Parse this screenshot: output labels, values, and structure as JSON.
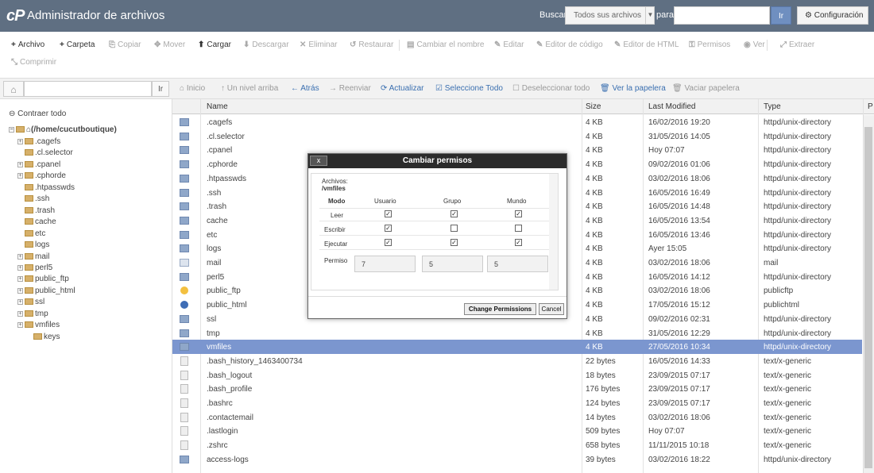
{
  "header": {
    "logo": "cP",
    "title": "Administrador de archivos",
    "search_label": "Buscar",
    "search_scope": "Todos sus archivos",
    "para_label": "para",
    "go_label": "Ir",
    "settings_label": "Configuración"
  },
  "toolbar": {
    "items": [
      {
        "icon": "+",
        "label": "Archivo",
        "enabled": true
      },
      {
        "icon": "+",
        "label": "Carpeta",
        "enabled": true
      },
      {
        "icon": "⎘",
        "label": "Copiar",
        "enabled": false
      },
      {
        "icon": "✥",
        "label": "Mover",
        "enabled": false
      },
      {
        "icon": "⬆",
        "label": "Cargar",
        "enabled": true
      },
      {
        "icon": "⬇",
        "label": "Descargar",
        "enabled": false
      },
      {
        "icon": "✕",
        "label": "Eliminar",
        "enabled": false
      },
      {
        "icon": "↺",
        "label": "Restaurar",
        "enabled": false
      },
      {
        "icon": "▤",
        "label": "Cambiar el nombre",
        "enabled": false
      },
      {
        "icon": "✎",
        "label": "Editar",
        "enabled": false
      },
      {
        "icon": "✎",
        "label": "Editor de código",
        "enabled": false
      },
      {
        "icon": "✎",
        "label": "Editor de HTML",
        "enabled": false
      },
      {
        "icon": "⚿",
        "label": "Permisos",
        "enabled": false
      },
      {
        "icon": "◉",
        "label": "Ver",
        "enabled": false
      },
      {
        "icon": "⤢",
        "label": "Extraer",
        "enabled": false
      },
      {
        "icon": "⤡",
        "label": "Comprimir",
        "enabled": false
      }
    ]
  },
  "navbar": {
    "go_label": "Ir",
    "items": [
      {
        "icon": "⌂",
        "label": "Inicio",
        "style": "gray"
      },
      {
        "icon": "↑",
        "label": "Un nivel arriba",
        "style": "gray"
      },
      {
        "icon": "←",
        "label": "Atrás",
        "style": "blue"
      },
      {
        "icon": "→",
        "label": "Reenviar",
        "style": "gray"
      },
      {
        "icon": "⟳",
        "label": "Actualizar",
        "style": "blue"
      },
      {
        "icon": "☑",
        "label": "Seleccione Todo",
        "style": "blue"
      },
      {
        "icon": "☐",
        "label": "Deseleccionar todo",
        "style": "gray"
      },
      {
        "icon": "🗑",
        "label": "Ver la papelera",
        "style": "blue"
      },
      {
        "icon": "🗑",
        "label": "Vaciar papelera",
        "style": "gray"
      }
    ]
  },
  "tree": {
    "collapse_label": "Contraer todo",
    "root": "(/home/cucutboutique)",
    "items": [
      {
        "name": ".cagefs",
        "pm": true
      },
      {
        "name": ".cl.selector",
        "pm": false
      },
      {
        "name": ".cpanel",
        "pm": true
      },
      {
        "name": ".cphorde",
        "pm": true
      },
      {
        "name": ".htpasswds",
        "pm": false
      },
      {
        "name": ".ssh",
        "pm": false
      },
      {
        "name": ".trash",
        "pm": false
      },
      {
        "name": "cache",
        "pm": false
      },
      {
        "name": "etc",
        "pm": false
      },
      {
        "name": "logs",
        "pm": false
      },
      {
        "name": "mail",
        "pm": true
      },
      {
        "name": "perl5",
        "pm": true
      },
      {
        "name": "public_ftp",
        "pm": true
      },
      {
        "name": "public_html",
        "pm": true
      },
      {
        "name": "ssl",
        "pm": true
      },
      {
        "name": "tmp",
        "pm": true
      },
      {
        "name": "vmfiles",
        "pm": true
      }
    ],
    "sub": "keys"
  },
  "table": {
    "headers": {
      "name": "Name",
      "size": "Size",
      "modified": "Last Modified",
      "type": "Type",
      "extra": "P"
    },
    "rows": [
      {
        "icon": "dir",
        "name": ".cagefs",
        "size": "4 KB",
        "modified": "16/02/2016 19:20",
        "type": "httpd/unix-directory"
      },
      {
        "icon": "dir",
        "name": ".cl.selector",
        "size": "4 KB",
        "modified": "31/05/2016 14:05",
        "type": "httpd/unix-directory"
      },
      {
        "icon": "dir",
        "name": ".cpanel",
        "size": "4 KB",
        "modified": "Hoy 07:07",
        "type": "httpd/unix-directory"
      },
      {
        "icon": "dir",
        "name": ".cphorde",
        "size": "4 KB",
        "modified": "09/02/2016 01:06",
        "type": "httpd/unix-directory"
      },
      {
        "icon": "dir",
        "name": ".htpasswds",
        "size": "4 KB",
        "modified": "03/02/2016 18:06",
        "type": "httpd/unix-directory"
      },
      {
        "icon": "dir",
        "name": ".ssh",
        "size": "4 KB",
        "modified": "16/05/2016 16:49",
        "type": "httpd/unix-directory"
      },
      {
        "icon": "dir",
        "name": ".trash",
        "size": "4 KB",
        "modified": "16/05/2016 14:48",
        "type": "httpd/unix-directory"
      },
      {
        "icon": "dir",
        "name": "cache",
        "size": "4 KB",
        "modified": "16/05/2016 13:54",
        "type": "httpd/unix-directory"
      },
      {
        "icon": "dir",
        "name": "etc",
        "size": "4 KB",
        "modified": "16/05/2016 13:46",
        "type": "httpd/unix-directory"
      },
      {
        "icon": "dir",
        "name": "logs",
        "size": "4 KB",
        "modified": "Ayer 15:05",
        "type": "httpd/unix-directory"
      },
      {
        "icon": "mail",
        "name": "mail",
        "size": "4 KB",
        "modified": "03/02/2016 18:06",
        "type": "mail"
      },
      {
        "icon": "dir",
        "name": "perl5",
        "size": "4 KB",
        "modified": "16/05/2016 14:12",
        "type": "httpd/unix-directory"
      },
      {
        "icon": "ftp",
        "name": "public_ftp",
        "size": "4 KB",
        "modified": "03/02/2016 18:06",
        "type": "publicftp"
      },
      {
        "icon": "www",
        "name": "public_html",
        "size": "4 KB",
        "modified": "17/05/2016 15:12",
        "type": "publichtml"
      },
      {
        "icon": "dir",
        "name": "ssl",
        "size": "4 KB",
        "modified": "09/02/2016 02:31",
        "type": "httpd/unix-directory"
      },
      {
        "icon": "dir",
        "name": "tmp",
        "size": "4 KB",
        "modified": "31/05/2016 12:29",
        "type": "httpd/unix-directory"
      },
      {
        "icon": "dir",
        "name": "vmfiles",
        "size": "4 KB",
        "modified": "27/05/2016 10:34",
        "type": "httpd/unix-directory",
        "selected": true
      },
      {
        "icon": "doc",
        "name": ".bash_history_1463400734",
        "size": "22 bytes",
        "modified": "16/05/2016 14:33",
        "type": "text/x-generic"
      },
      {
        "icon": "doc",
        "name": ".bash_logout",
        "size": "18 bytes",
        "modified": "23/09/2015 07:17",
        "type": "text/x-generic"
      },
      {
        "icon": "doc",
        "name": ".bash_profile",
        "size": "176 bytes",
        "modified": "23/09/2015 07:17",
        "type": "text/x-generic"
      },
      {
        "icon": "doc",
        "name": ".bashrc",
        "size": "124 bytes",
        "modified": "23/09/2015 07:17",
        "type": "text/x-generic"
      },
      {
        "icon": "doc",
        "name": ".contactemail",
        "size": "14 bytes",
        "modified": "03/02/2016 18:06",
        "type": "text/x-generic"
      },
      {
        "icon": "doc",
        "name": ".lastlogin",
        "size": "509 bytes",
        "modified": "Hoy 07:07",
        "type": "text/x-generic"
      },
      {
        "icon": "doc",
        "name": ".zshrc",
        "size": "658 bytes",
        "modified": "11/11/2015 10:18",
        "type": "text/x-generic"
      },
      {
        "icon": "dir",
        "name": "access-logs",
        "size": "39 bytes",
        "modified": "03/02/2016 18:22",
        "type": "httpd/unix-directory"
      }
    ]
  },
  "dialog": {
    "title": "Cambiar permisos",
    "close_label": "x",
    "files_label": "Archivos:",
    "file_path": "/vmfiles",
    "mode_label": "Modo",
    "cols": [
      "Usuario",
      "Grupo",
      "Mundo"
    ],
    "rows": [
      {
        "label": "Leer",
        "checks": [
          true,
          true,
          true
        ]
      },
      {
        "label": "Escribir",
        "checks": [
          true,
          false,
          false
        ]
      },
      {
        "label": "Ejecutar",
        "checks": [
          true,
          true,
          true
        ]
      }
    ],
    "perm_label": "Permiso",
    "perm_values": [
      "7",
      "5",
      "5"
    ],
    "change_label": "Change Permissions",
    "cancel_label": "Cancel"
  }
}
